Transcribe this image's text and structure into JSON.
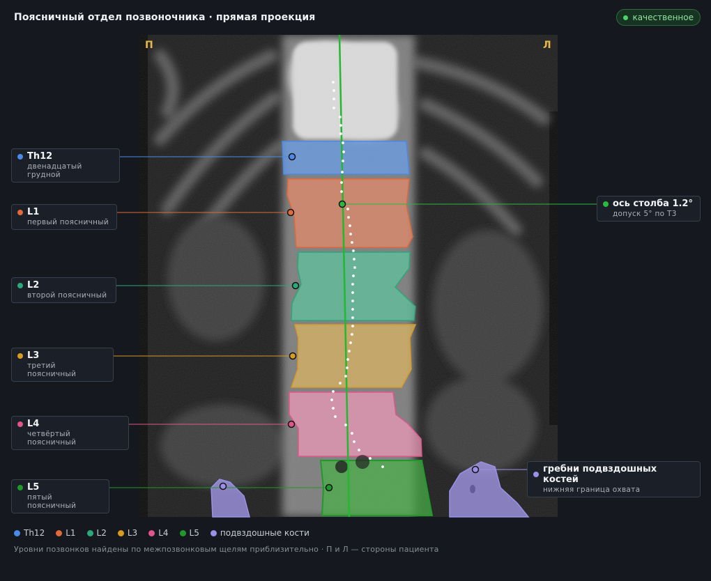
{
  "title": "Поясничный отдел позвоночника · прямая проекция",
  "badge": {
    "label": "качественное",
    "color": "#4cd46a"
  },
  "orientation": {
    "left": "П",
    "right": "Л"
  },
  "vertebrae": [
    {
      "id": "th12",
      "label": "Th12",
      "description": "двенадцатый грудной",
      "color": "#4a8ae8"
    },
    {
      "id": "l1",
      "label": "L1",
      "description": "первый поясничный",
      "color": "#e06a3a"
    },
    {
      "id": "l2",
      "label": "L2",
      "description": "второй поясничный",
      "color": "#2aa87a"
    },
    {
      "id": "l3",
      "label": "L3",
      "description": "третий поясничный",
      "color": "#d99a22"
    },
    {
      "id": "l4",
      "label": "L4",
      "description": "четвёртый поясничный",
      "color": "#e0568a"
    },
    {
      "id": "l5",
      "label": "L5",
      "description": "пятый поясничный",
      "color": "#1f9a2a"
    }
  ],
  "axis_callout": {
    "label": "ось столба 1.2°",
    "description": "допуск 5° по Т3",
    "color": "#2cb83e"
  },
  "iliac_callout": {
    "label": "гребни подвздошных костей",
    "description": "нижняя граница охвата",
    "color": "#9a90e8"
  },
  "legend": [
    {
      "label": "Th12",
      "color": "#4a8ae8"
    },
    {
      "label": "L1",
      "color": "#e06a3a"
    },
    {
      "label": "L2",
      "color": "#2aa87a"
    },
    {
      "label": "L3",
      "color": "#d99a22"
    },
    {
      "label": "L4",
      "color": "#e0568a"
    },
    {
      "label": "L5",
      "color": "#1f9a2a"
    },
    {
      "label": "подвздошные кости",
      "color": "#9a90e8"
    }
  ],
  "footnote": "Уровни позвонков найдены по межпозвонковым щелям приблизительно · П и Л — стороны пациента"
}
